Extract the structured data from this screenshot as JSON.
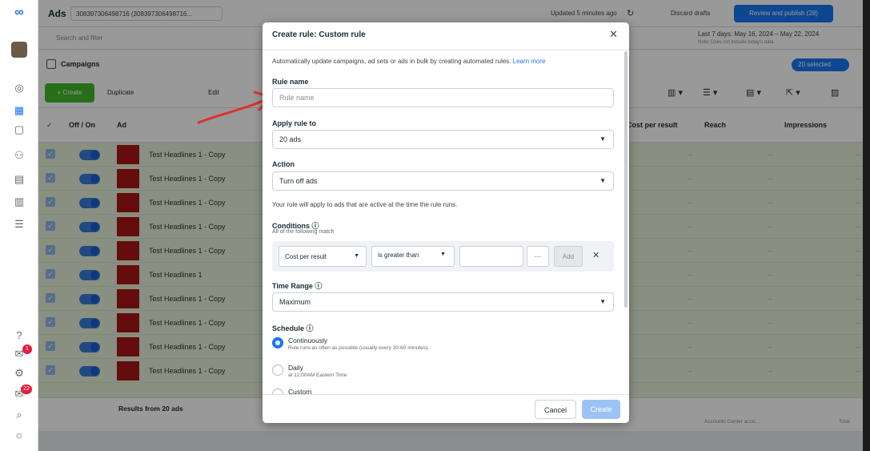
{
  "app": {
    "title": "Ads",
    "account": "308397306498716 (308397306498716...",
    "updated": "Updated 5 minutes ago",
    "discard": "Discard drafts",
    "review_publish": "Review and publish (28)"
  },
  "search": {
    "placeholder": "Search and filter",
    "date_range": "Last 7 days: May 16, 2024 – May 22, 2024",
    "date_note": "Note: Does not include today's data"
  },
  "tabs": {
    "campaigns": "Campaigns",
    "selected": "20 selected"
  },
  "toolbar": {
    "create": "+ Create",
    "duplicate": "Duplicate",
    "edit": "Edit"
  },
  "table": {
    "headers": {
      "offon": "Off / On",
      "ad": "Ad",
      "cost_per_result": "Cost per result",
      "reach": "Reach",
      "impressions": "Impressions"
    },
    "rows": [
      {
        "name": "Test Headlines 1 - Copy"
      },
      {
        "name": "Test Headlines 1 - Copy"
      },
      {
        "name": "Test Headlines 1 - Copy"
      },
      {
        "name": "Test Headlines 1 - Copy"
      },
      {
        "name": "Test Headlines 1 - Copy"
      },
      {
        "name": "Test Headlines 1"
      },
      {
        "name": "Test Headlines 1 - Copy"
      },
      {
        "name": "Test Headlines 1 - Copy"
      },
      {
        "name": "Test Headlines 1 - Copy"
      },
      {
        "name": "Test Headlines 1 - Copy"
      }
    ],
    "dash": "–",
    "footer_results": "Results from 20 ads",
    "footer_reach_note": "Accounts Center acco...",
    "footer_total": "Total"
  },
  "modal": {
    "title": "Create rule: Custom rule",
    "intro": "Automatically update campaigns, ad sets or ads in bulk by creating automated rules.",
    "learn_more": "Learn more",
    "rule_name_label": "Rule name",
    "rule_name_placeholder": "Rule name",
    "apply_label": "Apply rule to",
    "apply_value": "20 ads",
    "action_label": "Action",
    "action_value": "Turn off ads",
    "action_note": "Your rule will apply to ads that are active at the time the rule runs.",
    "conditions_label": "Conditions",
    "conditions_sub": "All of the following match",
    "condition_metric": "Cost per result",
    "condition_operator": "is greater than",
    "condition_more": "···",
    "condition_add": "Add",
    "time_range_label": "Time Range",
    "time_range_value": "Maximum",
    "schedule_label": "Schedule",
    "schedule_options": [
      {
        "title": "Continuously",
        "sub": "Rule runs as often as possible (usually every 30-60 minutes).",
        "checked": true
      },
      {
        "title": "Daily",
        "sub": "at 12:00AM Eastern Time",
        "checked": false
      },
      {
        "title": "Custom",
        "sub": "",
        "checked": false
      }
    ],
    "cancel": "Cancel",
    "create": "Create"
  },
  "badges": {
    "notif_1": "1",
    "notif_22": "22"
  },
  "colors": {
    "primary": "#1877f2",
    "create_green": "#42b72a",
    "annotation_red": "#e0302b"
  }
}
